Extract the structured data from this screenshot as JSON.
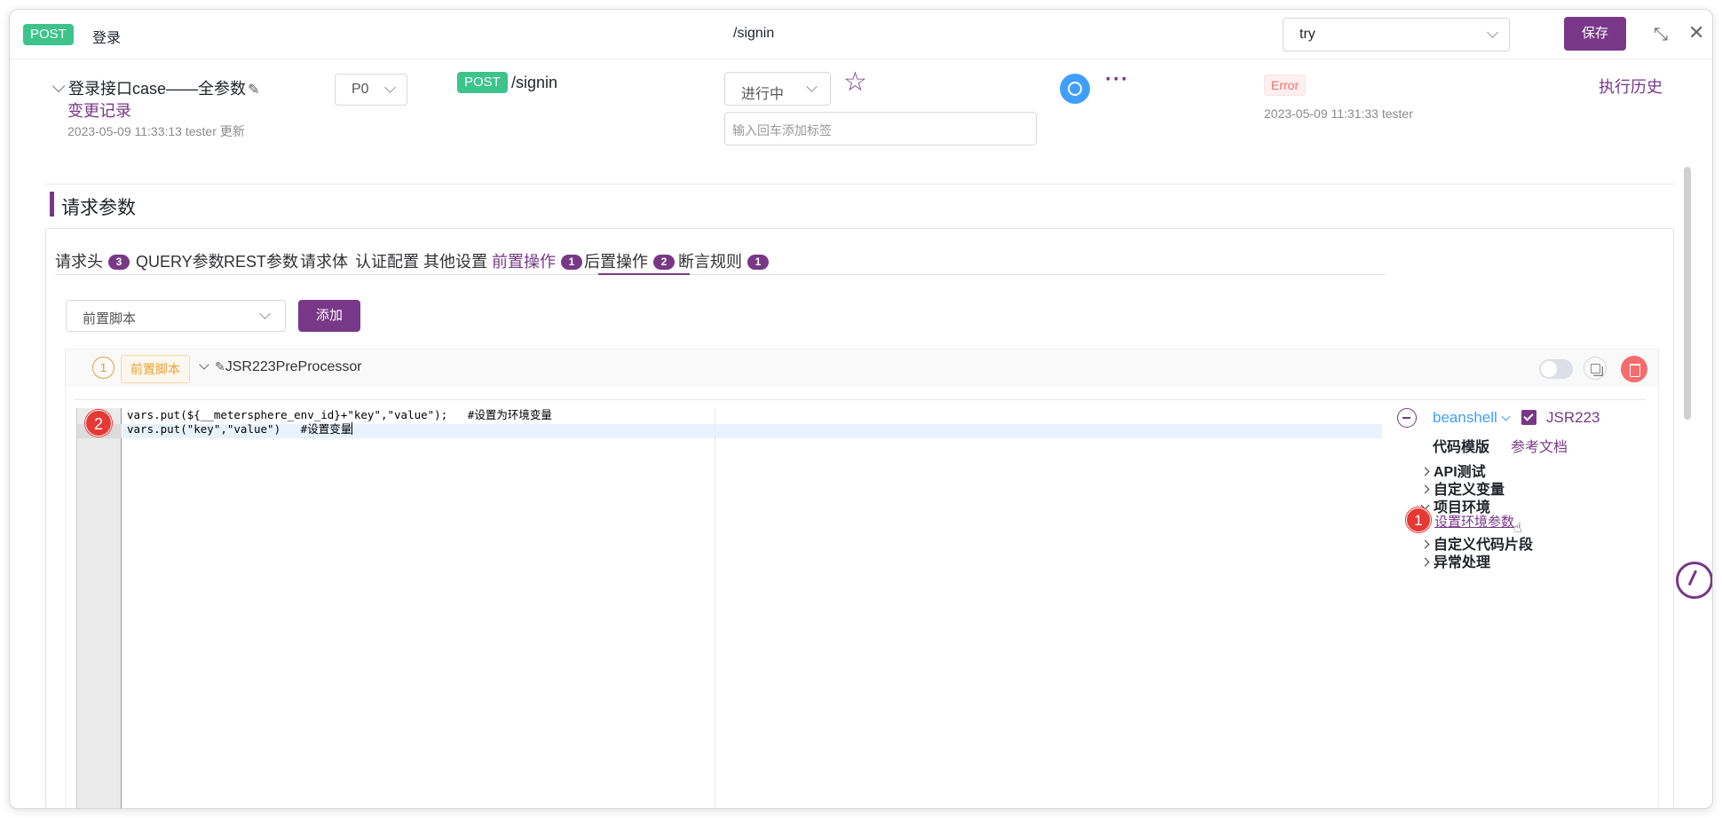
{
  "topbar": {
    "method": "POST",
    "name": "登录",
    "path": "/signin",
    "env_value": "try",
    "save_label": "保存"
  },
  "case": {
    "title": "登录接口case——全参数",
    "change_log": "变更记录",
    "update_meta": "2023-05-09 11:33:13 tester 更新",
    "priority": "P0",
    "method": "POST",
    "path": "/signin",
    "status": "进行中",
    "tag_placeholder": "输入回车添加标签",
    "result": "Error",
    "result_meta": "2023-05-09 11:31:33 tester",
    "history_label": "执行历史"
  },
  "section": {
    "title": "请求参数"
  },
  "tabs": [
    {
      "label": "请求头",
      "count": "3"
    },
    {
      "label": "QUERY参数"
    },
    {
      "label": "REST参数"
    },
    {
      "label": "请求体"
    },
    {
      "label": "认证配置"
    },
    {
      "label": "其他设置"
    },
    {
      "label": "前置操作",
      "count": "1",
      "active": true
    },
    {
      "label": "后置操作",
      "count": "2"
    },
    {
      "label": "断言规则",
      "count": "1"
    }
  ],
  "pre_ops": {
    "select_value": "前置脚本",
    "add_label": "添加"
  },
  "processor": {
    "index": "1",
    "type_tag": "前置脚本",
    "name": "JSR223PreProcessor",
    "code": [
      "vars.put(${__metersphere_env_id}+\"key\",\"value\");   #设置为环境变量",
      "vars.put(\"key\",\"value\")   #设置变量"
    ]
  },
  "side_panel": {
    "language": "beanshell",
    "engine_label": "JSR223",
    "template_label": "代码模版",
    "doc_link": "参考文档",
    "tree": [
      {
        "label": "API测试",
        "expanded": false
      },
      {
        "label": "自定义变量",
        "expanded": false
      },
      {
        "label": "项目环境",
        "expanded": true
      },
      {
        "label": "自定义代码片段",
        "expanded": false
      },
      {
        "label": "异常处理",
        "expanded": false
      }
    ],
    "tree_leaf": "设置环境参数"
  },
  "markers": {
    "marker_1": "1",
    "marker_2": "2"
  },
  "colors": {
    "brand": "#783887",
    "method_post": "#3cc48b",
    "error": "#f56c6c",
    "link_blue": "#409eff"
  }
}
